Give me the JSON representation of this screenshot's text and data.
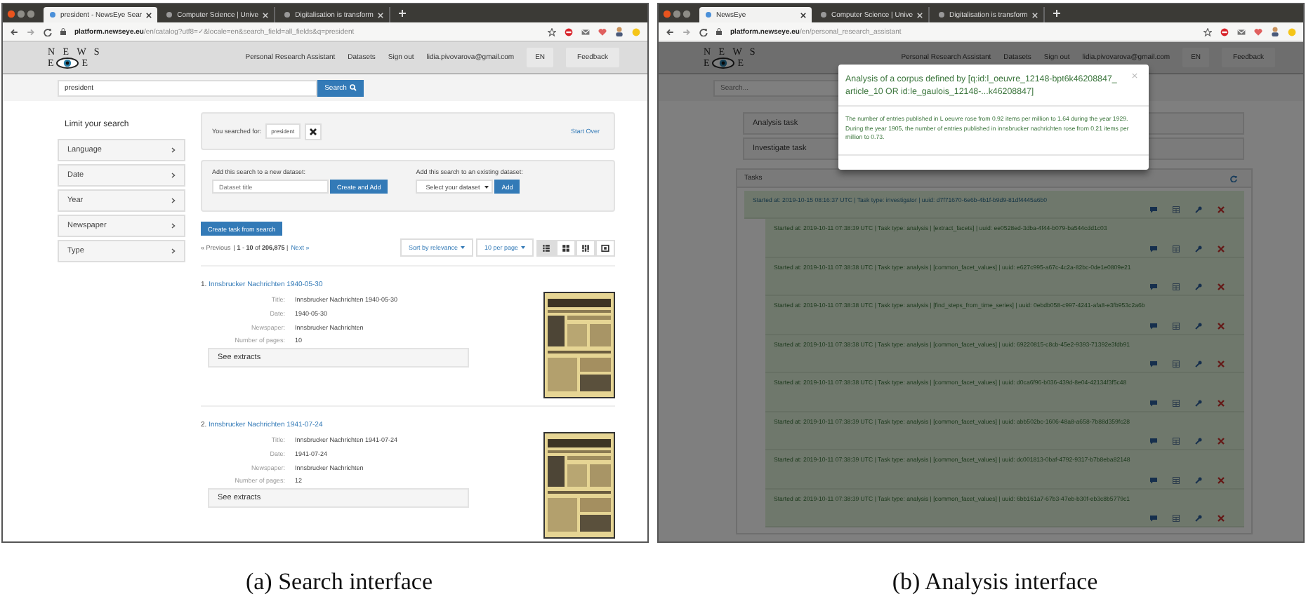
{
  "panels": [
    {
      "kind": "search",
      "caption": "(a) Search interface",
      "tabs": [
        {
          "label": "president - NewsEye Sear",
          "selected": true
        },
        {
          "label": "Computer Science | Unive",
          "selected": false
        },
        {
          "label": "Digitalisation is transform",
          "selected": false
        }
      ],
      "url": "**platform.newseye.eu**/en/catalog?utf8=✓&locale=en&search_field=all_fields&q=president",
      "header": {
        "logo_top": "N E W S",
        "logo_left": "E",
        "logo_right": "E",
        "nav": [
          "Personal Research Assistant",
          "Datasets",
          "Sign out",
          "lidia.pivovarova@gmail.com"
        ],
        "language": "EN",
        "feedback": "Feedback"
      },
      "search": {
        "value": "president",
        "button": "Search"
      },
      "sidebar": {
        "title": "Limit your search",
        "facets": [
          "Language",
          "Date",
          "Year",
          "Newspaper",
          "Type"
        ]
      },
      "searched": {
        "label": "You searched for:",
        "term": "president",
        "start_over": "Start Over"
      },
      "datasets": {
        "new_label": "Add this search to a new dataset:",
        "new_placeholder": "Dataset title",
        "create": "Create and Add",
        "existing_label": "Add this search to an existing dataset:",
        "select": "Select your dataset",
        "add": "Add"
      },
      "create_task": "Create task from search",
      "pagination": {
        "prev": "« Previous",
        "range": "| **1** - **10** of **206,875** |",
        "next": "Next »"
      },
      "sort": "Sort by relevance",
      "per_page": "10 per page",
      "views": [
        {
          "kind": "list",
          "selected": true
        },
        {
          "kind": "gallery",
          "selected": false
        },
        {
          "kind": "masonry",
          "selected": false
        },
        {
          "kind": "slideshow",
          "selected": false
        }
      ],
      "results": [
        {
          "number": "1.",
          "title": "Innsbrucker Nachrichten 1940-05-30",
          "fields": [
            {
              "label": "Title:",
              "value": "Innsbrucker Nachrichten 1940-05-30"
            },
            {
              "label": "Date:",
              "value": "1940-05-30"
            },
            {
              "label": "Newspaper:",
              "value": "Innsbrucker Nachrichten"
            },
            {
              "label": "Number of pages:",
              "value": "10"
            }
          ],
          "extracts": "See extracts",
          "thumbnail": {
            "kind": "picture"
          }
        },
        {
          "number": "2.",
          "title": "Innsbrucker Nachrichten 1941-07-24",
          "fields": [
            {
              "label": "Title:",
              "value": "Innsbrucker Nachrichten 1941-07-24"
            },
            {
              "label": "Date:",
              "value": "1941-07-24"
            },
            {
              "label": "Newspaper:",
              "value": "Innsbrucker Nachrichten"
            },
            {
              "label": "Number of pages:",
              "value": "12"
            }
          ],
          "extracts": "See extracts",
          "thumbnail": {
            "kind": "picture"
          }
        }
      ]
    },
    {
      "kind": "analysis",
      "caption": "(b) Analysis interface",
      "tabs": [
        {
          "label": "NewsEye",
          "selected": true
        },
        {
          "label": "Computer Science | Unive",
          "selected": false
        },
        {
          "label": "Digitalisation is transform",
          "selected": false
        }
      ],
      "url": "**platform.newseye.eu**/en/personal_research_assistant",
      "header": {
        "logo_top": "N E W S",
        "logo_left": "E",
        "logo_right": "E",
        "nav": [
          "Personal Research Assistant",
          "Datasets",
          "Sign out",
          "lidia.pivovarova@gmail.com"
        ],
        "language": "EN",
        "feedback": "Feedback"
      },
      "search": {
        "placeholder": "Search..."
      },
      "task_buttons": [
        "Analysis task",
        "Investigate task"
      ],
      "tasks_title": "Tasks",
      "tasks": [
        {
          "text": "Started at: 2019-10-15 08:16:37 UTC | Task type: investigator | uuid: d7f71670-6e6b-4b1f-b9d9-81df4445a6b0",
          "children": [
            {
              "text": "Started at: 2019-10-11 07:38:39 UTC | Task type: analysis | [extract_facets] | uuid: ee0528ed-3dba-4f44-b079-ba544cdd1c03"
            },
            {
              "text": "Started at: 2019-10-11 07:38:38 UTC | Task type: analysis | [common_facet_values] | uuid: e627c995-a67c-4c2a-82bc-0de1e0809e21"
            },
            {
              "text": "Started at: 2019-10-11 07:38:38 UTC | Task type: analysis | [find_steps_from_time_series] | uuid: 0ebdb058-c997-4241-afa8-e3fb953c2a6b"
            },
            {
              "text": "Started at: 2019-10-11 07:38:38 UTC | Task type: analysis | [common_facet_values] | uuid: 69220815-c8cb-45e2-9393-71392e3fdb91"
            },
            {
              "text": "Started at: 2019-10-11 07:38:38 UTC | Task type: analysis | [common_facet_values] | uuid: d0ca6f96-b036-439d-8e04-42134f3f5c48"
            },
            {
              "text": "Started at: 2019-10-11 07:38:39 UTC | Task type: analysis | [common_facet_values] | uuid: abb502bc-1606-48a8-a658-7b88d359fc28"
            },
            {
              "text": "Started at: 2019-10-11 07:38:39 UTC | Task type: analysis | [common_facet_values] | uuid: dc001813-0baf-4792-9317-b7b8eba82148"
            },
            {
              "text": "Started at: 2019-10-11 07:38:39 UTC | Task type: analysis | [common_facet_values] | uuid: 6bb161a7-67b3-47eb-b30f-eb3c8b5779c1"
            }
          ]
        }
      ],
      "modal": {
        "title": "Analysis of a corpus defined by [q:id:l_oeuvre_12148-bpt6k46208847_article_10 OR id:le_gaulois_12148-...k46208847]",
        "body": "The number of entries published in L oeuvre rose from 0.92 items per million to 1.64 during the year 1929. During the year 1905, the number of entries published in innsbrucker nachrichten rose from 0.21 items per million to 0.73."
      }
    }
  ]
}
